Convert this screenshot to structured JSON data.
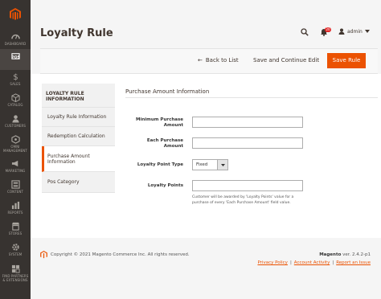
{
  "sidebar": {
    "items": [
      {
        "label": "DASHBOARD",
        "icon": "dashboard-icon"
      },
      {
        "label": "POS",
        "icon": "pos-icon"
      },
      {
        "label": "SALES",
        "icon": "dollar-icon"
      },
      {
        "label": "CATALOG",
        "icon": "cube-icon"
      },
      {
        "label": "CUSTOMERS",
        "icon": "person-icon"
      },
      {
        "label": "OMNI",
        "label2": "MANAGEMENT",
        "icon": "omni-icon"
      },
      {
        "label": "MARKETING",
        "icon": "megaphone-icon"
      },
      {
        "label": "CONTENT",
        "icon": "content-icon"
      },
      {
        "label": "REPORTS",
        "icon": "bar-chart-icon"
      },
      {
        "label": "STORES",
        "icon": "store-icon"
      },
      {
        "label": "SYSTEM",
        "icon": "gear-icon"
      },
      {
        "label": "FIND PARTNERS",
        "label2": "& EXTENSIONS",
        "icon": "extensions-icon"
      }
    ]
  },
  "header": {
    "title": "Loyalty Rule",
    "notification_count": "20",
    "user": "admin"
  },
  "actions": {
    "back": "Back to List",
    "save_continue": "Save and Continue Edit",
    "save": "Save Rule"
  },
  "tabs": {
    "title": "LOYALTY RULE INFORMATION",
    "items": [
      "Loyalty Rule Information",
      "Redemption Calculation",
      "Purchase Amount Information",
      "Pos Category"
    ]
  },
  "form": {
    "section_title": "Purchase Amount Information",
    "min_amount_label": "Minimum Purchase Amount",
    "min_amount_value": "",
    "each_amount_label": "Each Purchase Amount",
    "each_amount_value": "",
    "point_type_label": "Loyalty Point Type",
    "point_type_value": "Fixed",
    "points_label": "Loyalty Points",
    "points_value": "",
    "points_note": "Customer will be awarded by 'Loyalty Points' value for a purchase of every 'Each Purchase Amount' field value."
  },
  "footer": {
    "copyright": "Copyright © 2021 Magento Commerce Inc. All rights reserved.",
    "product": "Magento",
    "version": "ver. 2.4.2-p1",
    "links": [
      "Privacy Policy",
      "Account Activity",
      "Report an Issue"
    ]
  },
  "colors": {
    "accent": "#eb5202",
    "sidebar_bg": "#373330",
    "badge": "#e22626"
  }
}
